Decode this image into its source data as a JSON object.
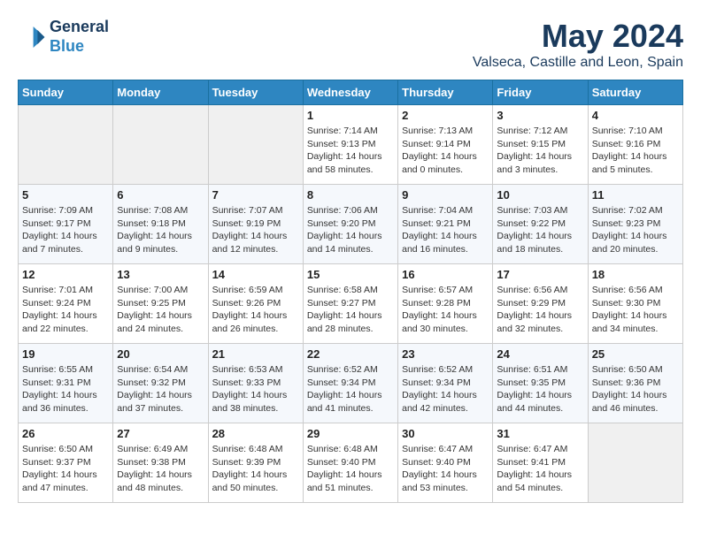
{
  "header": {
    "logo_line1": "General",
    "logo_line2": "Blue",
    "month": "May 2024",
    "location": "Valseca, Castille and Leon, Spain"
  },
  "weekdays": [
    "Sunday",
    "Monday",
    "Tuesday",
    "Wednesday",
    "Thursday",
    "Friday",
    "Saturday"
  ],
  "weeks": [
    [
      {
        "day": "",
        "info": ""
      },
      {
        "day": "",
        "info": ""
      },
      {
        "day": "",
        "info": ""
      },
      {
        "day": "1",
        "info": "Sunrise: 7:14 AM\nSunset: 9:13 PM\nDaylight: 14 hours\nand 58 minutes."
      },
      {
        "day": "2",
        "info": "Sunrise: 7:13 AM\nSunset: 9:14 PM\nDaylight: 14 hours\nand 0 minutes."
      },
      {
        "day": "3",
        "info": "Sunrise: 7:12 AM\nSunset: 9:15 PM\nDaylight: 14 hours\nand 3 minutes."
      },
      {
        "day": "4",
        "info": "Sunrise: 7:10 AM\nSunset: 9:16 PM\nDaylight: 14 hours\nand 5 minutes."
      }
    ],
    [
      {
        "day": "5",
        "info": "Sunrise: 7:09 AM\nSunset: 9:17 PM\nDaylight: 14 hours\nand 7 minutes."
      },
      {
        "day": "6",
        "info": "Sunrise: 7:08 AM\nSunset: 9:18 PM\nDaylight: 14 hours\nand 9 minutes."
      },
      {
        "day": "7",
        "info": "Sunrise: 7:07 AM\nSunset: 9:19 PM\nDaylight: 14 hours\nand 12 minutes."
      },
      {
        "day": "8",
        "info": "Sunrise: 7:06 AM\nSunset: 9:20 PM\nDaylight: 14 hours\nand 14 minutes."
      },
      {
        "day": "9",
        "info": "Sunrise: 7:04 AM\nSunset: 9:21 PM\nDaylight: 14 hours\nand 16 minutes."
      },
      {
        "day": "10",
        "info": "Sunrise: 7:03 AM\nSunset: 9:22 PM\nDaylight: 14 hours\nand 18 minutes."
      },
      {
        "day": "11",
        "info": "Sunrise: 7:02 AM\nSunset: 9:23 PM\nDaylight: 14 hours\nand 20 minutes."
      }
    ],
    [
      {
        "day": "12",
        "info": "Sunrise: 7:01 AM\nSunset: 9:24 PM\nDaylight: 14 hours\nand 22 minutes."
      },
      {
        "day": "13",
        "info": "Sunrise: 7:00 AM\nSunset: 9:25 PM\nDaylight: 14 hours\nand 24 minutes."
      },
      {
        "day": "14",
        "info": "Sunrise: 6:59 AM\nSunset: 9:26 PM\nDaylight: 14 hours\nand 26 minutes."
      },
      {
        "day": "15",
        "info": "Sunrise: 6:58 AM\nSunset: 9:27 PM\nDaylight: 14 hours\nand 28 minutes."
      },
      {
        "day": "16",
        "info": "Sunrise: 6:57 AM\nSunset: 9:28 PM\nDaylight: 14 hours\nand 30 minutes."
      },
      {
        "day": "17",
        "info": "Sunrise: 6:56 AM\nSunset: 9:29 PM\nDaylight: 14 hours\nand 32 minutes."
      },
      {
        "day": "18",
        "info": "Sunrise: 6:56 AM\nSunset: 9:30 PM\nDaylight: 14 hours\nand 34 minutes."
      }
    ],
    [
      {
        "day": "19",
        "info": "Sunrise: 6:55 AM\nSunset: 9:31 PM\nDaylight: 14 hours\nand 36 minutes."
      },
      {
        "day": "20",
        "info": "Sunrise: 6:54 AM\nSunset: 9:32 PM\nDaylight: 14 hours\nand 37 minutes."
      },
      {
        "day": "21",
        "info": "Sunrise: 6:53 AM\nSunset: 9:33 PM\nDaylight: 14 hours\nand 38 minutes."
      },
      {
        "day": "22",
        "info": "Sunrise: 6:52 AM\nSunset: 9:34 PM\nDaylight: 14 hours\nand 41 minutes."
      },
      {
        "day": "23",
        "info": "Sunrise: 6:52 AM\nSunset: 9:34 PM\nDaylight: 14 hours\nand 42 minutes."
      },
      {
        "day": "24",
        "info": "Sunrise: 6:51 AM\nSunset: 9:35 PM\nDaylight: 14 hours\nand 44 minutes."
      },
      {
        "day": "25",
        "info": "Sunrise: 6:50 AM\nSunset: 9:36 PM\nDaylight: 14 hours\nand 46 minutes."
      }
    ],
    [
      {
        "day": "26",
        "info": "Sunrise: 6:50 AM\nSunset: 9:37 PM\nDaylight: 14 hours\nand 47 minutes."
      },
      {
        "day": "27",
        "info": "Sunrise: 6:49 AM\nSunset: 9:38 PM\nDaylight: 14 hours\nand 48 minutes."
      },
      {
        "day": "28",
        "info": "Sunrise: 6:48 AM\nSunset: 9:39 PM\nDaylight: 14 hours\nand 50 minutes."
      },
      {
        "day": "29",
        "info": "Sunrise: 6:48 AM\nSunset: 9:40 PM\nDaylight: 14 hours\nand 51 minutes."
      },
      {
        "day": "30",
        "info": "Sunrise: 6:47 AM\nSunset: 9:40 PM\nDaylight: 14 hours\nand 53 minutes."
      },
      {
        "day": "31",
        "info": "Sunrise: 6:47 AM\nSunset: 9:41 PM\nDaylight: 14 hours\nand 54 minutes."
      },
      {
        "day": "",
        "info": ""
      }
    ]
  ]
}
